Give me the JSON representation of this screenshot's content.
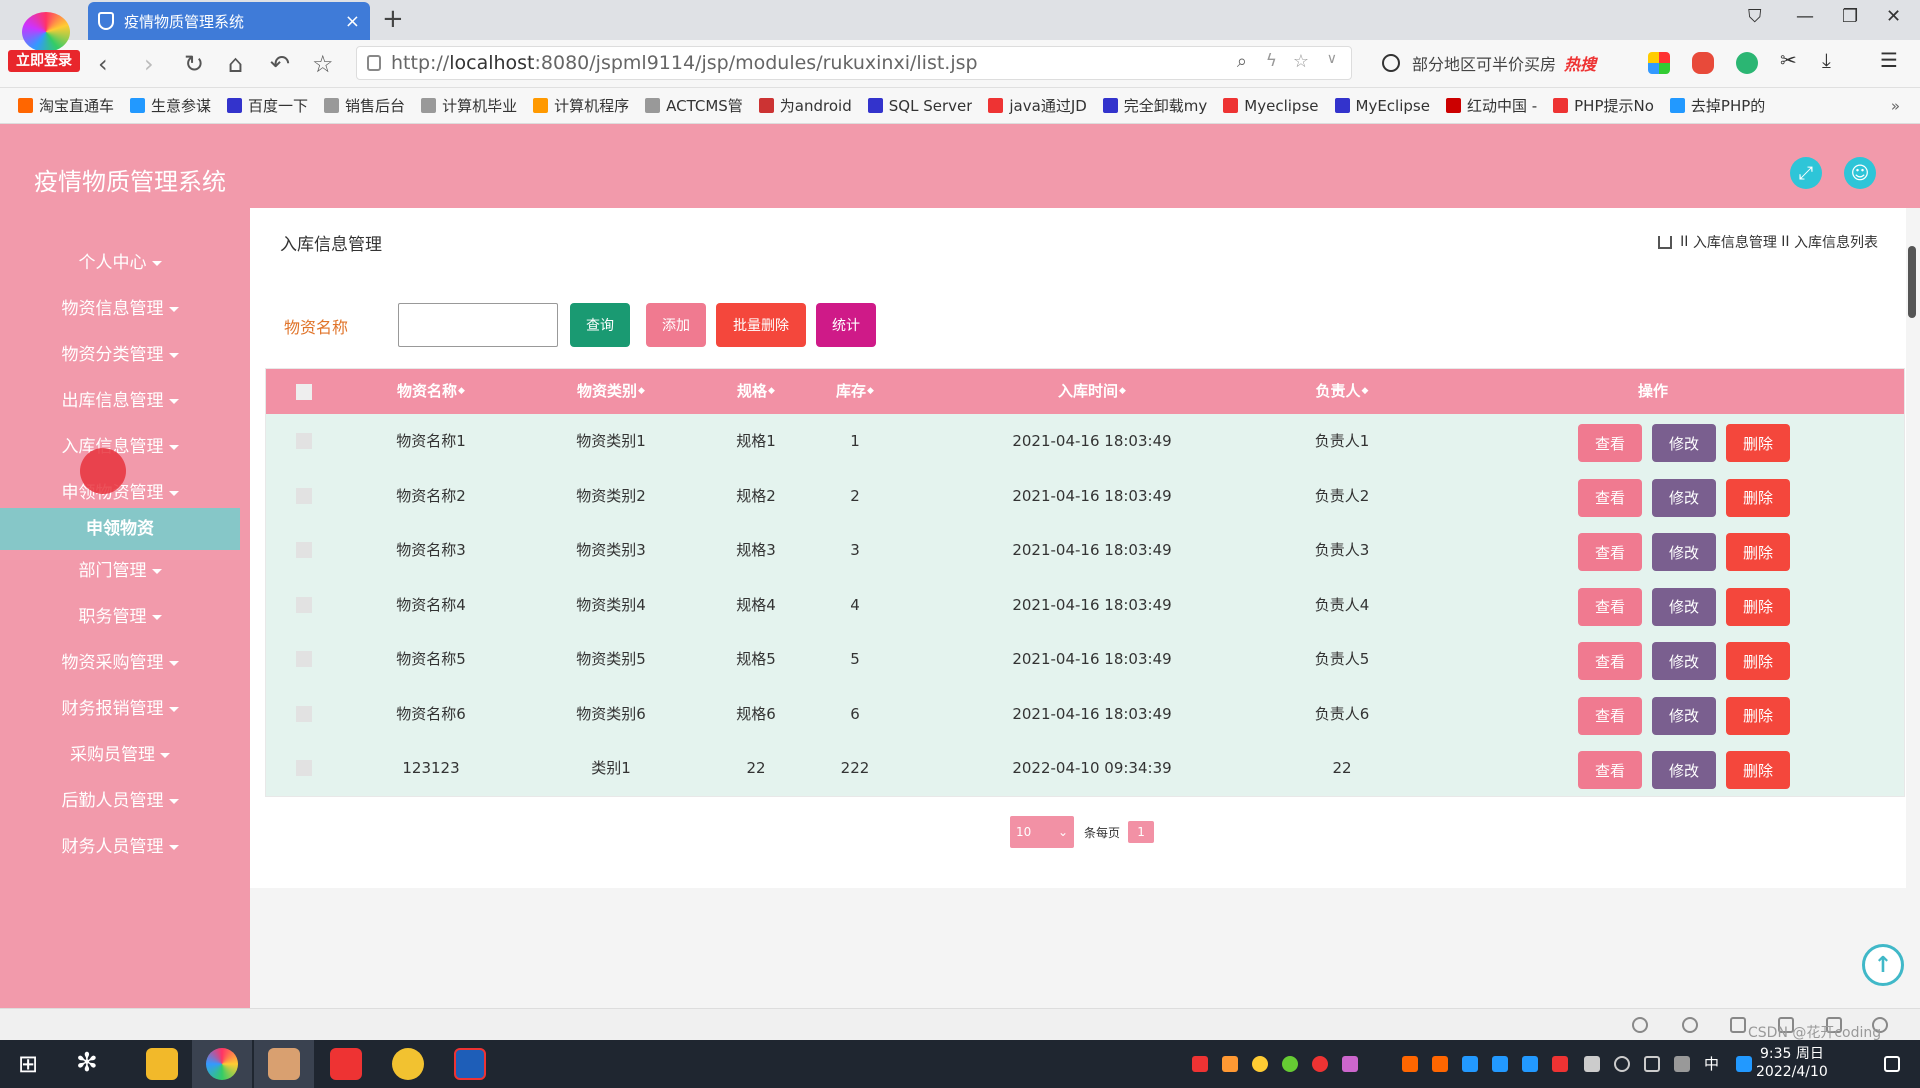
{
  "browser": {
    "login_badge": "立即登录",
    "tab_title": "疫情物质管理系统",
    "tab_close": "×",
    "new_tab": "+",
    "url_prefix": "http://",
    "url_host": "localhost",
    "url_path": ":8080/jspml9114/jsp/modules/rukuxinxi/list.jsp",
    "search_text": "部分地区可半价买房",
    "search_hot": "热搜",
    "bookmarks": [
      "淘宝直通车",
      "生意参谋",
      "百度一下",
      "销售后台",
      "计算机毕业",
      "计算机程序",
      "ACTCMS管",
      "为android",
      "SQL Server",
      "java通过JD",
      "完全卸载my",
      "Myeclipse",
      "MyEclipse",
      "红动中国 -",
      "PHP提示No",
      "去掉PHP的"
    ],
    "bookmarks_more": "»"
  },
  "app": {
    "title": "疫情物质管理系统"
  },
  "sidebar": {
    "items": [
      "个人中心",
      "物资信息管理",
      "物资分类管理",
      "出库信息管理",
      "入库信息管理",
      "申领物资管理",
      "部门管理",
      "职务管理",
      "物资采购管理",
      "财务报销管理",
      "采购员管理",
      "后勤人员管理",
      "财务人员管理"
    ],
    "active_submenu": "申领物资"
  },
  "page": {
    "heading": "入库信息管理",
    "breadcrumb": [
      "入库信息管理",
      "入库信息列表"
    ],
    "breadcrumb_sep": "II"
  },
  "search": {
    "label": "物资名称",
    "value": "",
    "buttons": {
      "query": "查询",
      "add": "添加",
      "batch_delete": "批量删除",
      "stats": "统计"
    }
  },
  "table": {
    "columns": [
      "物资名称",
      "物资类别",
      "规格",
      "库存",
      "入库时间",
      "负责人",
      "操作"
    ],
    "sort_icon": "◆",
    "rows": [
      {
        "name": "物资名称1",
        "category": "物资类别1",
        "spec": "规格1",
        "stock": "1",
        "time": "2021-04-16 18:03:49",
        "owner": "负责人1"
      },
      {
        "name": "物资名称2",
        "category": "物资类别2",
        "spec": "规格2",
        "stock": "2",
        "time": "2021-04-16 18:03:49",
        "owner": "负责人2"
      },
      {
        "name": "物资名称3",
        "category": "物资类别3",
        "spec": "规格3",
        "stock": "3",
        "time": "2021-04-16 18:03:49",
        "owner": "负责人3"
      },
      {
        "name": "物资名称4",
        "category": "物资类别4",
        "spec": "规格4",
        "stock": "4",
        "time": "2021-04-16 18:03:49",
        "owner": "负责人4"
      },
      {
        "name": "物资名称5",
        "category": "物资类别5",
        "spec": "规格5",
        "stock": "5",
        "time": "2021-04-16 18:03:49",
        "owner": "负责人5"
      },
      {
        "name": "物资名称6",
        "category": "物资类别6",
        "spec": "规格6",
        "stock": "6",
        "time": "2021-04-16 18:03:49",
        "owner": "负责人6"
      },
      {
        "name": "123123",
        "category": "类别1",
        "spec": "22",
        "stock": "222",
        "time": "2022-04-10 09:34:39",
        "owner": "22"
      }
    ],
    "row_actions": {
      "view": "查看",
      "edit": "修改",
      "delete": "删除"
    }
  },
  "pager": {
    "page_size": "10",
    "per_page_label": "条每页",
    "current_page": "1"
  },
  "taskbar": {
    "time": "9:35 周日",
    "date": "2022/4/10",
    "ime": "中",
    "watermark": "CSDN @花开coding"
  },
  "colors": {
    "header": "#f29aab",
    "submenu_active": "#86c7c8",
    "btn_query": "#1a9a72",
    "btn_add": "#f07a90",
    "btn_batch_delete": "#f4473c",
    "btn_stats": "#cf1a88",
    "row_view": "#f07a90",
    "row_edit": "#7a5f8f",
    "row_delete": "#f4473c"
  }
}
